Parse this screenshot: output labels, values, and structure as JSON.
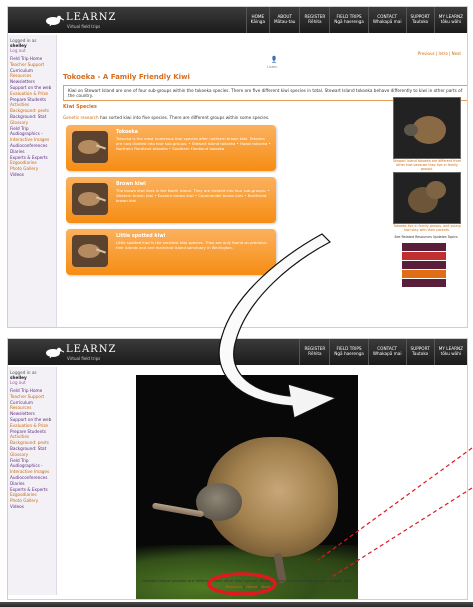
{
  "header": {
    "logo_title": "LEARNZ",
    "logo_subtitle": "Virtual field trips",
    "nav": [
      {
        "top": "HOME",
        "bottom": "Kāinga"
      },
      {
        "top": "ABOUT",
        "bottom": "Mātau-tau"
      },
      {
        "top": "REGISTER",
        "bottom": "Rēhita"
      },
      {
        "top": "FIELD TRIPS",
        "bottom": "Ngā haerenga"
      },
      {
        "top": "CONTACT",
        "bottom": "Whakapā mai"
      },
      {
        "top": "SUPPORT",
        "bottom": "Tautoko"
      },
      {
        "top": "MY LEARNZ",
        "bottom": "tōku wāhi"
      }
    ]
  },
  "header2_nav": [
    {
      "top": "REGISTER",
      "bottom": "Rēhita"
    },
    {
      "top": "FIELD TRIPS",
      "bottom": "Ngā haerenga"
    },
    {
      "top": "CONTACT",
      "bottom": "Whakapā mai"
    },
    {
      "top": "SUPPORT",
      "bottom": "Tautoko"
    },
    {
      "top": "MY LEARNZ",
      "bottom": "tōku wāhi"
    }
  ],
  "sidebar": {
    "logged_prefix": "Logged in as",
    "user": "shelley",
    "logout": "Log out",
    "items": [
      {
        "label": "Field Trip Home",
        "alt": false
      },
      {
        "label": "Teacher Support",
        "alt": true
      },
      {
        "label": "Curriculum",
        "alt": false
      },
      {
        "label": "Resources",
        "alt": true
      },
      {
        "label": "Newsletters",
        "alt": false
      },
      {
        "label": "Support on the web",
        "alt": false
      },
      {
        "label": "Evaluation & Prize",
        "alt": true
      },
      {
        "label": "Prepare Students",
        "alt": false
      },
      {
        "label": "Activities",
        "alt": true
      },
      {
        "label": "Background: pests",
        "alt": true
      },
      {
        "label": "Background: Stat",
        "alt": false
      },
      {
        "label": "Glossary",
        "alt": true
      },
      {
        "label": "Field Trip",
        "alt": false
      },
      {
        "label": "Audiographics -",
        "alt": false
      },
      {
        "label": "Interactive Images",
        "alt": true
      },
      {
        "label": "Audioconferences",
        "alt": false
      },
      {
        "label": "Diaries",
        "alt": false
      },
      {
        "label": "Experts & Experts",
        "alt": false
      },
      {
        "label": "Ezgoodiaries",
        "alt": true
      },
      {
        "label": "Photo Gallery",
        "alt": true
      },
      {
        "label": "Videos",
        "alt": false
      }
    ]
  },
  "main": {
    "breadcrumb_right": "Previous | Intro | Next",
    "speaker_label": "Listen",
    "title": "Tokoeka - A Family Friendly Kiwi",
    "intro": "Kiwi on Stewart Island are one of four sub-groups within the tokoeka species. There are five different kiwi species in total. Stewart Island tokoeka behave differently to kiwi in other parts of the country.",
    "section_heading": "Kiwi Species",
    "research_link": "Genetic research",
    "research_text": " has sorted kiwi into five species. There are different groups within some species.",
    "cards": [
      {
        "title": "Tokoeka",
        "body": "Tokoeka is the most numerous kiwi species after northern brown kiwi. Tokoeka are now divided into four sub-groups: • Stewart Island tokoeka • Haast tokoeka • Northern Fiordland tokoeka • Southern Fiordland tokoeka"
      },
      {
        "title": "Brown kiwi",
        "body": "The brown kiwi lives in the North Island. They are divided into four sub-groups: • Western brown kiwi • Eastern brown kiwi • Coromandel brown kiwi • Northland brown kiwi"
      },
      {
        "title": "Little spotted kiwi",
        "body": "Little spotted kiwi is the smallest kiwi species. They are only found on predator-free islands and one mainland island sanctuary in Wellington."
      }
    ],
    "photo_caption_1": "Stewart Island tokoeka are different from other kiwi because they live in family groups.",
    "photo_caption_2": "Tokoeka live in family groups, and young kiwi stay with their parents.",
    "stack_label": "See Related Resources Updates Topics"
  },
  "viewer": {
    "caption": "Stewart Island tokoeka are different from other kiwi species because they live in family groups. Image: DOC.",
    "prev": "Previous",
    "sep1": " | ",
    "home": "Home",
    "sep2": " | ",
    "next": "Next"
  },
  "colors": {
    "accent_orange": "#f68d14",
    "annotation_red": "#e0191f",
    "nav_dark": "#1b1b1b"
  }
}
